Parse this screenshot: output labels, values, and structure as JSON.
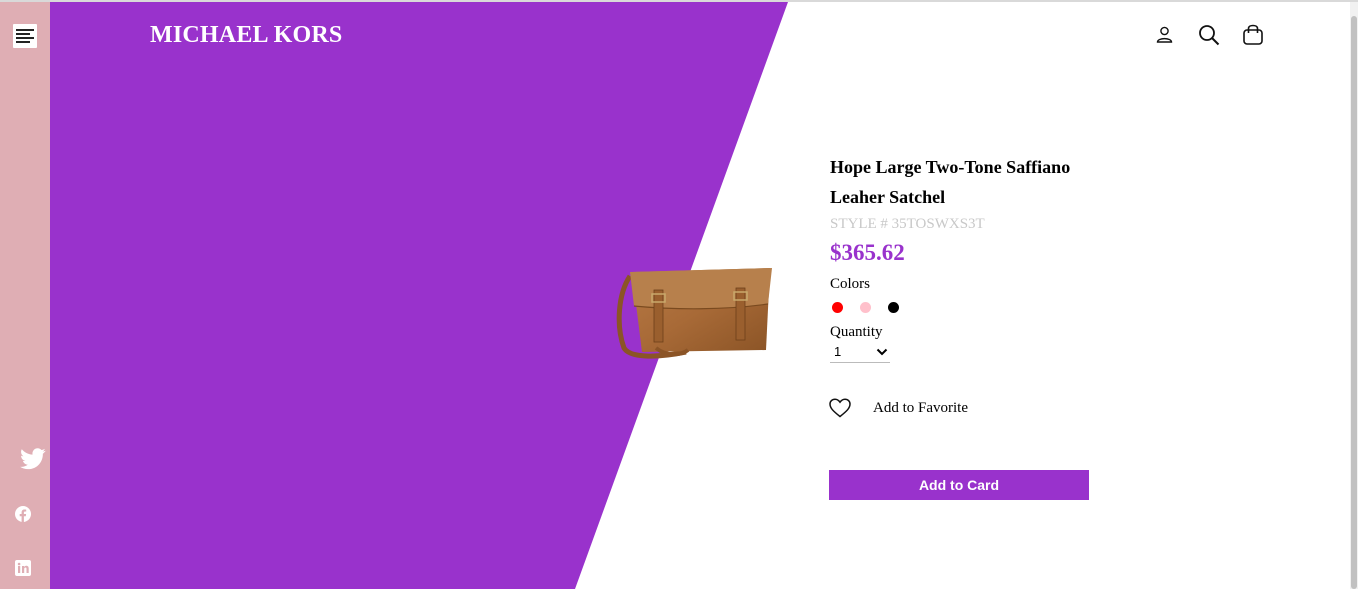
{
  "brand": {
    "name": "MICHAEL KORS",
    "accent_color": "#9932cc",
    "sidebar_color": "#dfaeb4"
  },
  "sidebar": {
    "menu_icon": "hamburger-menu-icon",
    "social": [
      "twitter-icon",
      "facebook-icon",
      "linkedin-icon"
    ]
  },
  "header": {
    "icons": [
      "user-icon",
      "search-icon",
      "shopping-bag-icon"
    ]
  },
  "product": {
    "title": "Hope Large Two-Tone Saffiano Leaher Satchel",
    "style": "STYLE # 35TOSWXS3T",
    "price": "$365.62",
    "colors_label": "Colors",
    "colors": [
      "#ff0000",
      "#ffc0cb",
      "#000000"
    ],
    "quantity_label": "Quantity",
    "quantity_value": "1",
    "favorite_label": "Add to Favorite",
    "cart_button": "Add to Card"
  }
}
